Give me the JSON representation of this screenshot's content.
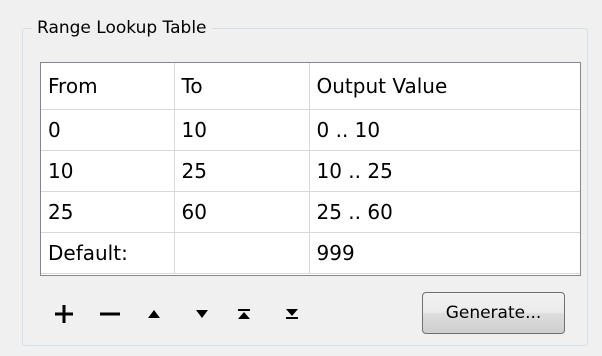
{
  "group": {
    "title": "Range Lookup Table"
  },
  "table": {
    "headers": [
      "From",
      "To",
      "Output Value"
    ],
    "rows": [
      [
        "0",
        "10",
        "0 .. 10"
      ],
      [
        "10",
        "25",
        "10 .. 25"
      ],
      [
        "25",
        "60",
        "25 .. 60"
      ],
      [
        "Default:",
        "",
        "999"
      ]
    ]
  },
  "toolbar": {
    "icons": [
      "plus-icon",
      "minus-icon",
      "move-up-icon",
      "move-down-icon",
      "move-top-icon",
      "move-bottom-icon"
    ],
    "generate_label": "Generate..."
  }
}
